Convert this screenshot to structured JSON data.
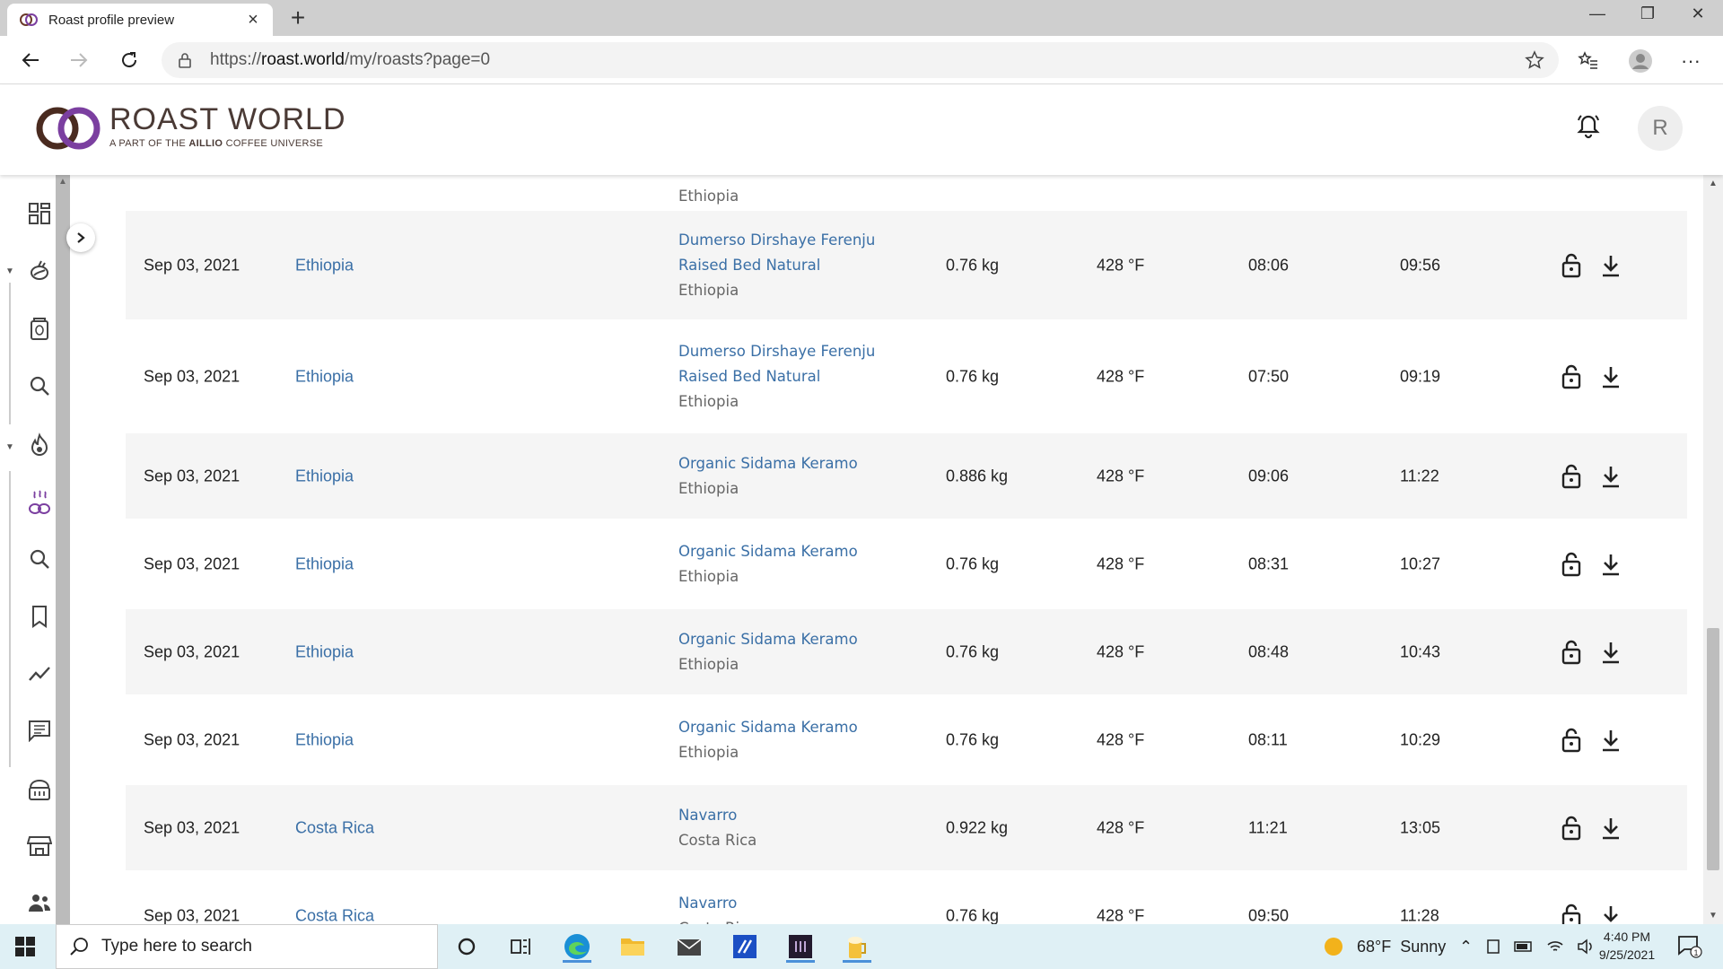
{
  "browser": {
    "tab_title": "Roast profile preview",
    "url_prefix": "https://",
    "url_domain": "roast.world",
    "url_path": "/my/roasts?page=0"
  },
  "header": {
    "logo_title": "ROAST WORLD",
    "logo_sub_before": "A PART OF THE ",
    "logo_sub_brand": "AILLIO",
    "logo_sub_after": " COFFEE UNIVERSE",
    "avatar_initial": "R"
  },
  "partial_row": {
    "origin_sub": "Ethiopia"
  },
  "rows": [
    {
      "date": "Sep 03, 2021",
      "origin": "Ethiopia",
      "bean": "Dumerso Dirshaye Ferenju",
      "bean2": "Raised Bed Natural",
      "bean_origin": "Ethiopia",
      "weight": "0.76 kg",
      "temp": "428 °F",
      "t1": "08:06",
      "t2": "09:56"
    },
    {
      "date": "Sep 03, 2021",
      "origin": "Ethiopia",
      "bean": "Dumerso Dirshaye Ferenju",
      "bean2": "Raised Bed Natural",
      "bean_origin": "Ethiopia",
      "weight": "0.76 kg",
      "temp": "428 °F",
      "t1": "07:50",
      "t2": "09:19"
    },
    {
      "date": "Sep 03, 2021",
      "origin": "Ethiopia",
      "bean": "Organic Sidama Keramo",
      "bean2": "",
      "bean_origin": "Ethiopia",
      "weight": "0.886 kg",
      "temp": "428 °F",
      "t1": "09:06",
      "t2": "11:22"
    },
    {
      "date": "Sep 03, 2021",
      "origin": "Ethiopia",
      "bean": "Organic Sidama Keramo",
      "bean2": "",
      "bean_origin": "Ethiopia",
      "weight": "0.76 kg",
      "temp": "428 °F",
      "t1": "08:31",
      "t2": "10:27"
    },
    {
      "date": "Sep 03, 2021",
      "origin": "Ethiopia",
      "bean": "Organic Sidama Keramo",
      "bean2": "",
      "bean_origin": "Ethiopia",
      "weight": "0.76 kg",
      "temp": "428 °F",
      "t1": "08:48",
      "t2": "10:43"
    },
    {
      "date": "Sep 03, 2021",
      "origin": "Ethiopia",
      "bean": "Organic Sidama Keramo",
      "bean2": "",
      "bean_origin": "Ethiopia",
      "weight": "0.76 kg",
      "temp": "428 °F",
      "t1": "08:11",
      "t2": "10:29"
    },
    {
      "date": "Sep 03, 2021",
      "origin": "Costa Rica",
      "bean": "Navarro",
      "bean2": "",
      "bean_origin": "Costa Rica",
      "weight": "0.922 kg",
      "temp": "428 °F",
      "t1": "11:21",
      "t2": "13:05"
    },
    {
      "date": "Sep 03, 2021",
      "origin": "Costa Rica",
      "bean": "Navarro",
      "bean2": "",
      "bean_origin": "Costa Rica",
      "weight": "0.76 kg",
      "temp": "428 °F",
      "t1": "09:50",
      "t2": "11:28"
    }
  ],
  "taskbar": {
    "search_placeholder": "Type here to search",
    "weather": "68°F  Sunny",
    "time": "4:40 PM",
    "date": "9/25/2021",
    "notifications": "1"
  },
  "colors": {
    "link": "#3a6fa6",
    "accent_purple": "#7b3fa0"
  }
}
